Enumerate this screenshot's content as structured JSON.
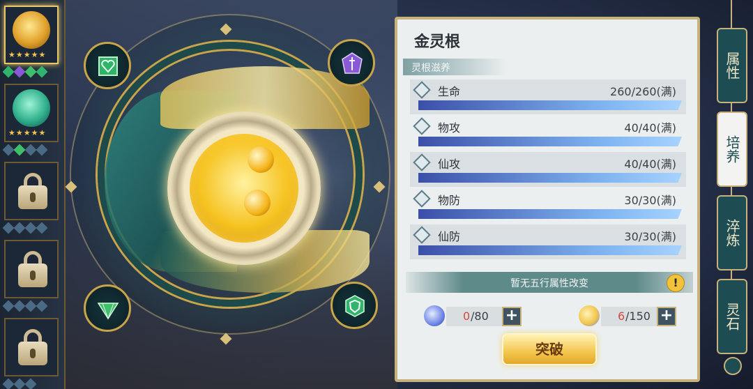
{
  "left_slots": {
    "slots": [
      {
        "type": "root",
        "element": "gold",
        "stars": 5,
        "selected": true
      },
      {
        "type": "root",
        "element": "jade",
        "stars": 5,
        "selected": false
      },
      {
        "type": "locked"
      },
      {
        "type": "locked"
      },
      {
        "type": "locked"
      }
    ],
    "star_glyphs": "★★★★★"
  },
  "wheel": {
    "sockets": [
      {
        "icon": "green-heart-gem-icon",
        "color": "#2fb56a"
      },
      {
        "icon": "purple-sword-crystal-icon",
        "color": "#8a5ad6"
      },
      {
        "icon": "green-crystal-icon",
        "color": "#3fbf6a"
      },
      {
        "icon": "green-shield-gem-icon",
        "color": "#32b46e"
      }
    ]
  },
  "panel": {
    "title": "金灵根",
    "subtitle": "灵根滋养",
    "stats": [
      {
        "name": "生命",
        "value": "260/260(满)",
        "fill": 1.0
      },
      {
        "name": "物攻",
        "value": "40/40(满)",
        "fill": 1.0
      },
      {
        "name": "仙攻",
        "value": "40/40(满)",
        "fill": 1.0
      },
      {
        "name": "物防",
        "value": "30/30(满)",
        "fill": 1.0
      },
      {
        "name": "仙防",
        "value": "30/30(满)",
        "fill": 1.0
      }
    ],
    "notice": "暂无五行属性改变",
    "warn_glyph": "!",
    "resources": [
      {
        "icon": "blue-crystal-icon",
        "current": "0",
        "max": "/80"
      },
      {
        "icon": "gold-pill-icon",
        "current": "6",
        "max": "/150"
      }
    ],
    "plus_glyph": "+",
    "breakthrough_label": "突破"
  },
  "tabs": [
    {
      "label": "属性",
      "active": false
    },
    {
      "label": "培养",
      "active": true
    },
    {
      "label": "淬炼",
      "active": false
    },
    {
      "label": "灵石",
      "active": false
    }
  ],
  "colors": {
    "panel_bg": "#eceff0",
    "bar": "#3f4f97",
    "accent_gold": "#c6b27a",
    "tab_teal": "#1d4c52",
    "resource_current": "#d8453f"
  }
}
